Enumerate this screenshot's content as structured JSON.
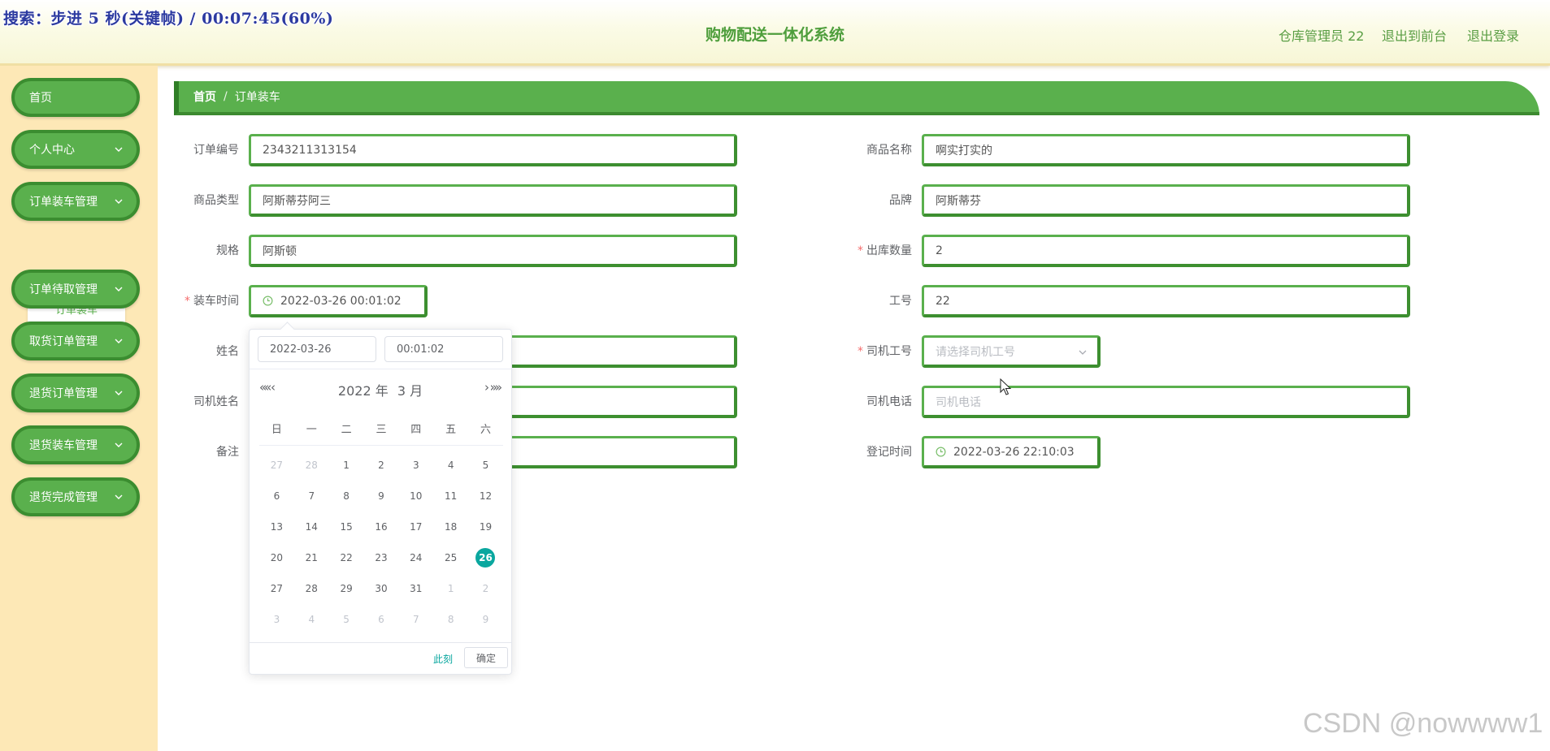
{
  "overlay_text": "搜索：步进 5 秒(关键帧) / 00:07:45(60%)",
  "header": {
    "title": "购物配送一体化系统",
    "user": "仓库管理员 22",
    "link_front": "退出到前台",
    "link_logout": "退出登录"
  },
  "sidebar": {
    "items": [
      {
        "label": "首页"
      },
      {
        "label": "个人中心"
      },
      {
        "label": "订单装车管理"
      },
      {
        "label": "订单待取管理"
      },
      {
        "label": "取货订单管理"
      },
      {
        "label": "退货订单管理"
      },
      {
        "label": "退货装车管理"
      },
      {
        "label": "退货完成管理"
      }
    ],
    "submenu": "订单装车"
  },
  "breadcrumb": {
    "home": "首页",
    "separator": "/",
    "current": "订单装车"
  },
  "form": {
    "order_no": {
      "label": "订单编号",
      "value": "2343211313154"
    },
    "product_name": {
      "label": "商品名称",
      "value": "啊实打实的"
    },
    "product_type": {
      "label": "商品类型",
      "value": "阿斯蒂芬阿三"
    },
    "brand": {
      "label": "品牌",
      "value": "阿斯蒂芬"
    },
    "spec": {
      "label": "规格",
      "value": "阿斯顿"
    },
    "out_qty": {
      "label": "出库数量",
      "value": "2"
    },
    "load_time": {
      "label": "装车时间",
      "value": "2022-03-26 00:01:02"
    },
    "work_no": {
      "label": "工号",
      "value": "22"
    },
    "name": {
      "label": "姓名",
      "value": ""
    },
    "driver_no": {
      "label": "司机工号",
      "placeholder": "请选择司机工号"
    },
    "driver_name": {
      "label": "司机姓名",
      "value": ""
    },
    "driver_phone": {
      "label": "司机电话",
      "placeholder": "司机电话"
    },
    "remark": {
      "label": "备注",
      "value": ""
    },
    "register_time": {
      "label": "登记时间",
      "value": "2022-03-26 22:10:03"
    }
  },
  "date_picker": {
    "date_input": "2022-03-26",
    "time_input": "00:01:02",
    "year": "2022 年",
    "month": "3 月",
    "weekdays": [
      "日",
      "一",
      "二",
      "三",
      "四",
      "五",
      "六"
    ],
    "weeks": [
      [
        {
          "d": "27",
          "o": true
        },
        {
          "d": "28",
          "o": true
        },
        {
          "d": "1"
        },
        {
          "d": "2"
        },
        {
          "d": "3"
        },
        {
          "d": "4"
        },
        {
          "d": "5"
        }
      ],
      [
        {
          "d": "6"
        },
        {
          "d": "7"
        },
        {
          "d": "8"
        },
        {
          "d": "9"
        },
        {
          "d": "10"
        },
        {
          "d": "11"
        },
        {
          "d": "12"
        }
      ],
      [
        {
          "d": "13"
        },
        {
          "d": "14"
        },
        {
          "d": "15"
        },
        {
          "d": "16"
        },
        {
          "d": "17"
        },
        {
          "d": "18"
        },
        {
          "d": "19"
        }
      ],
      [
        {
          "d": "20"
        },
        {
          "d": "21"
        },
        {
          "d": "22"
        },
        {
          "d": "23"
        },
        {
          "d": "24"
        },
        {
          "d": "25"
        },
        {
          "d": "26",
          "s": true
        }
      ],
      [
        {
          "d": "27"
        },
        {
          "d": "28"
        },
        {
          "d": "29"
        },
        {
          "d": "30"
        },
        {
          "d": "31"
        },
        {
          "d": "1",
          "o": true
        },
        {
          "d": "2",
          "o": true
        }
      ],
      [
        {
          "d": "3",
          "o": true
        },
        {
          "d": "4",
          "o": true
        },
        {
          "d": "5",
          "o": true
        },
        {
          "d": "6",
          "o": true
        },
        {
          "d": "7",
          "o": true
        },
        {
          "d": "8",
          "o": true
        },
        {
          "d": "9",
          "o": true
        }
      ]
    ],
    "now_label": "此刻",
    "confirm_label": "确定"
  },
  "watermark": "CSDN @nowwww1",
  "colors": {
    "primary_green": "#5ab04d",
    "dark_green": "#3b8d30",
    "sidebar_bg": "#fde8b6",
    "selected_day": "#0aa79f",
    "required": "#f56c6c"
  },
  "icons": {
    "dropdown": "chevron-down-icon",
    "time": "clock-icon",
    "pointer": "mouse-cursor-icon"
  }
}
